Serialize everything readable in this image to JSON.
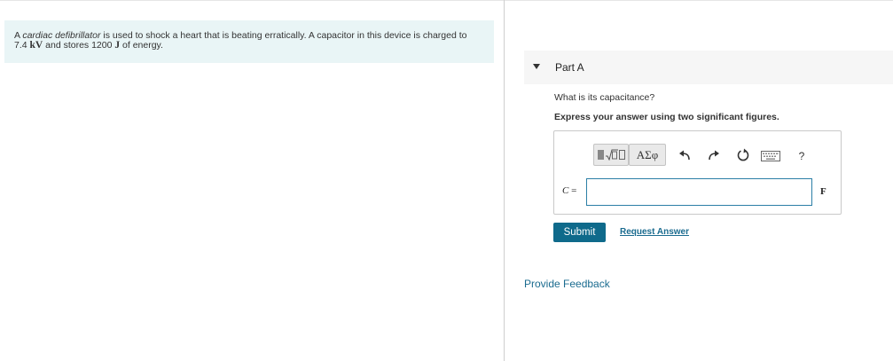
{
  "problem": {
    "italic_term": "cardiac defibrillator",
    "line1_prefix": "A ",
    "line1_suffix": " is used to shock a heart that is beating erratically. A capacitor in this device is charged to",
    "voltage_value": "7.4 ",
    "voltage_unit": "kV",
    "line2_mid": " and stores 1200 ",
    "energy_unit": "J",
    "line2_suffix": " of energy."
  },
  "part": {
    "title": "Part A",
    "question": "What is its capacitance?",
    "instruction": "Express your answer using two significant figures."
  },
  "toolbar": {
    "symbols_label": "ΑΣφ",
    "help_label": "?",
    "icons": [
      "template-icon",
      "symbols-icon",
      "undo-icon",
      "redo-icon",
      "reset-icon",
      "keyboard-icon",
      "help-icon"
    ]
  },
  "answer": {
    "variable": "C",
    "equals": " =",
    "value": "",
    "unit": "F"
  },
  "actions": {
    "submit_label": "Submit",
    "request_answer_label": "Request Answer",
    "feedback_label": "Provide Feedback"
  },
  "colors": {
    "problem_bg": "#e9f5f6",
    "submit_bg": "#0f6a8b",
    "link": "#1a6b8f",
    "input_border": "#2c7fa6"
  }
}
